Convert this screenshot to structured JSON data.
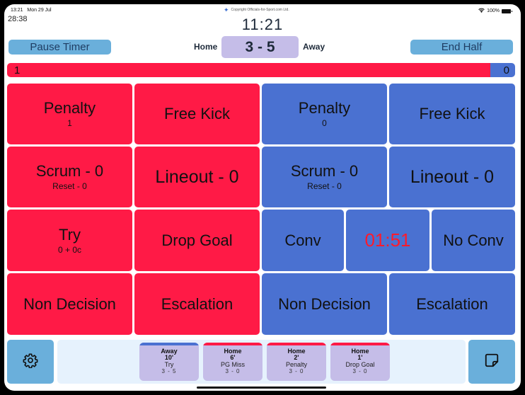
{
  "status_bar": {
    "time": "13:21",
    "date": "Mon 29 Jul",
    "battery": "100%"
  },
  "elapsed_time": "28:38",
  "copyright": "Copyright Officials-for-Sport.com Ltd.",
  "match_clock": "11:21",
  "header": {
    "pause_label": "Pause Timer",
    "end_half_label": "End Half",
    "home_label": "Home",
    "away_label": "Away",
    "score": "3 - 5"
  },
  "possession": {
    "home": "1",
    "away": "0",
    "home_fraction": 0.95
  },
  "colors": {
    "home": "#ff1a46",
    "away": "#4a71d1",
    "button": "#6aafdb",
    "score_bg": "#c5bde8"
  },
  "home": {
    "penalty": {
      "label": "Penalty",
      "count": "1"
    },
    "free_kick": {
      "label": "Free Kick"
    },
    "scrum": {
      "label": "Scrum - 0",
      "sub": "Reset - 0"
    },
    "lineout": {
      "label": "Lineout - 0"
    },
    "try": {
      "label": "Try",
      "sub": "0 + 0c"
    },
    "drop_goal": {
      "label": "Drop Goal"
    },
    "non_decision": {
      "label": "Non Decision"
    },
    "escalation": {
      "label": "Escalation"
    }
  },
  "away": {
    "penalty": {
      "label": "Penalty",
      "count": "0"
    },
    "free_kick": {
      "label": "Free Kick"
    },
    "scrum": {
      "label": "Scrum - 0",
      "sub": "Reset - 0"
    },
    "lineout": {
      "label": "Lineout - 0"
    },
    "conv": {
      "label": "Conv"
    },
    "conv_timer": "01:51",
    "no_conv": {
      "label": "No Conv"
    },
    "non_decision": {
      "label": "Non Decision"
    },
    "escalation": {
      "label": "Escalation"
    }
  },
  "log": [
    {
      "team": "Away",
      "minute": "10'",
      "event": "Try",
      "score": "3 - 5",
      "side": "away"
    },
    {
      "team": "Home",
      "minute": "6'",
      "event": "PG Miss",
      "score": "3 - 0",
      "side": "home"
    },
    {
      "team": "Home",
      "minute": "2'",
      "event": "Penalty",
      "score": "3 - 0",
      "side": "home"
    },
    {
      "team": "Home",
      "minute": "1'",
      "event": "Drop Goal",
      "score": "3 - 0",
      "side": "home"
    }
  ],
  "icons": {
    "settings": "gear-icon",
    "notes": "sticky-note-icon",
    "wifi": "wifi-icon",
    "battery": "battery-icon"
  }
}
